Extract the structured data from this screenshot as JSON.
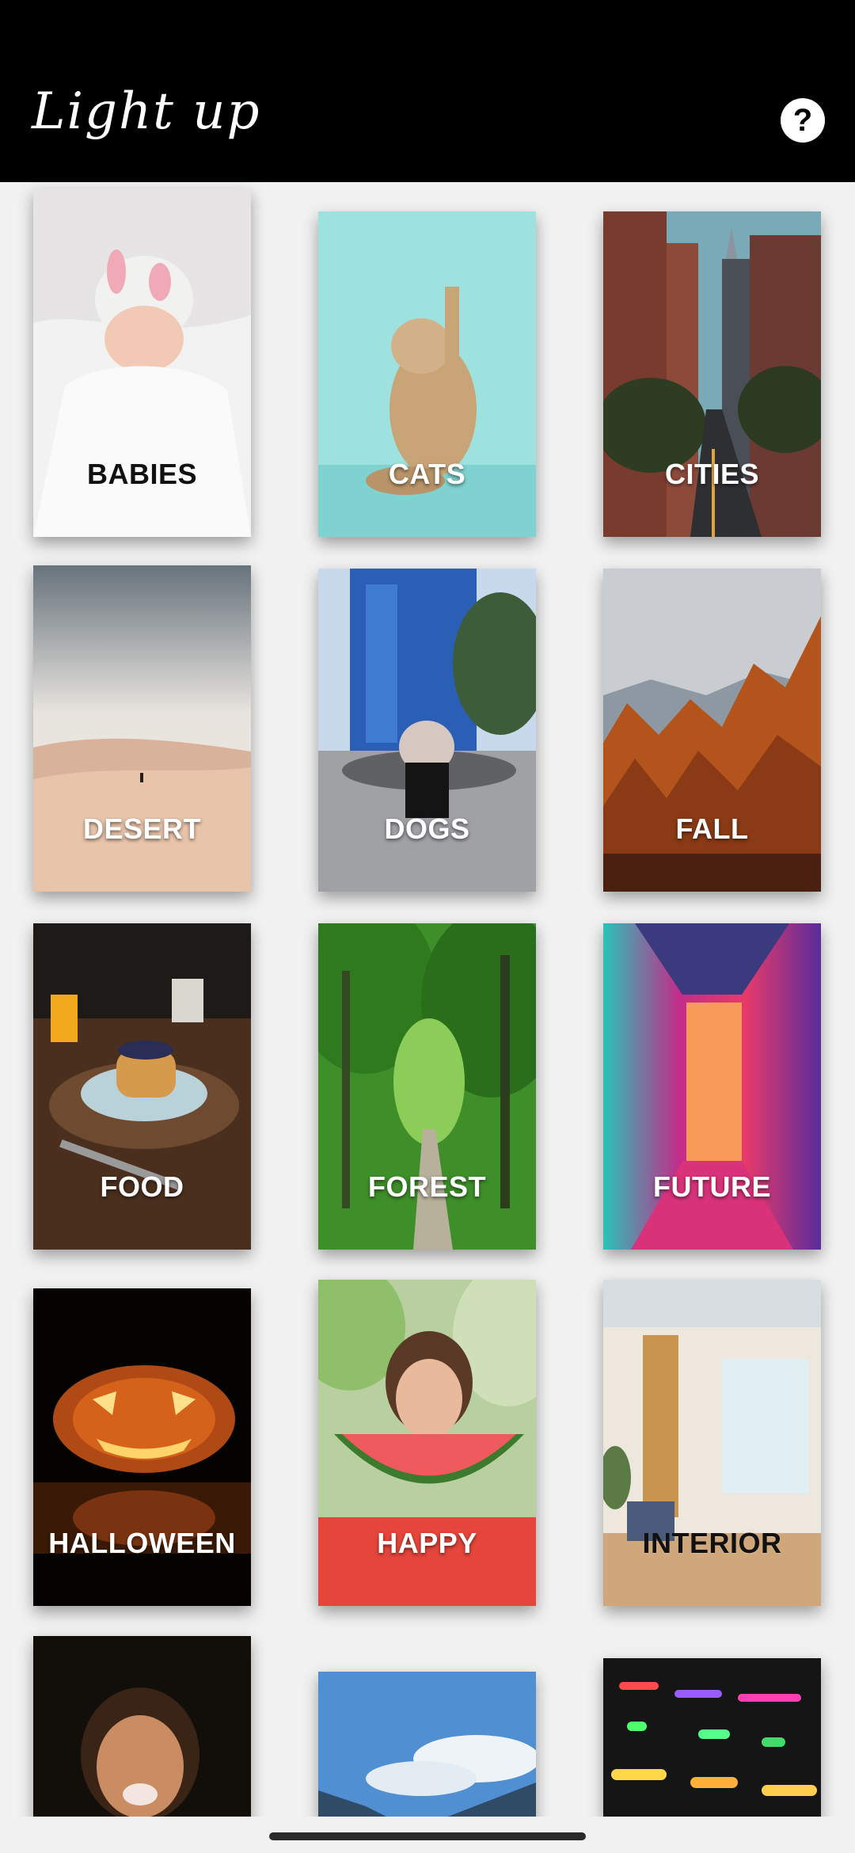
{
  "app": {
    "title": "Light up",
    "help_icon": "help-icon",
    "help_symbol": "?"
  },
  "categories": [
    {
      "label": "BABIES"
    },
    {
      "label": "CATS"
    },
    {
      "label": "CITIES"
    },
    {
      "label": "DESERT"
    },
    {
      "label": "DOGS"
    },
    {
      "label": "FALL"
    },
    {
      "label": "FOOD"
    },
    {
      "label": "FOREST"
    },
    {
      "label": "FUTURE"
    },
    {
      "label": "HALLOWEEN"
    },
    {
      "label": "HAPPY"
    },
    {
      "label": "INTERIOR"
    },
    {
      "label": ""
    },
    {
      "label": ""
    },
    {
      "label": ""
    }
  ]
}
